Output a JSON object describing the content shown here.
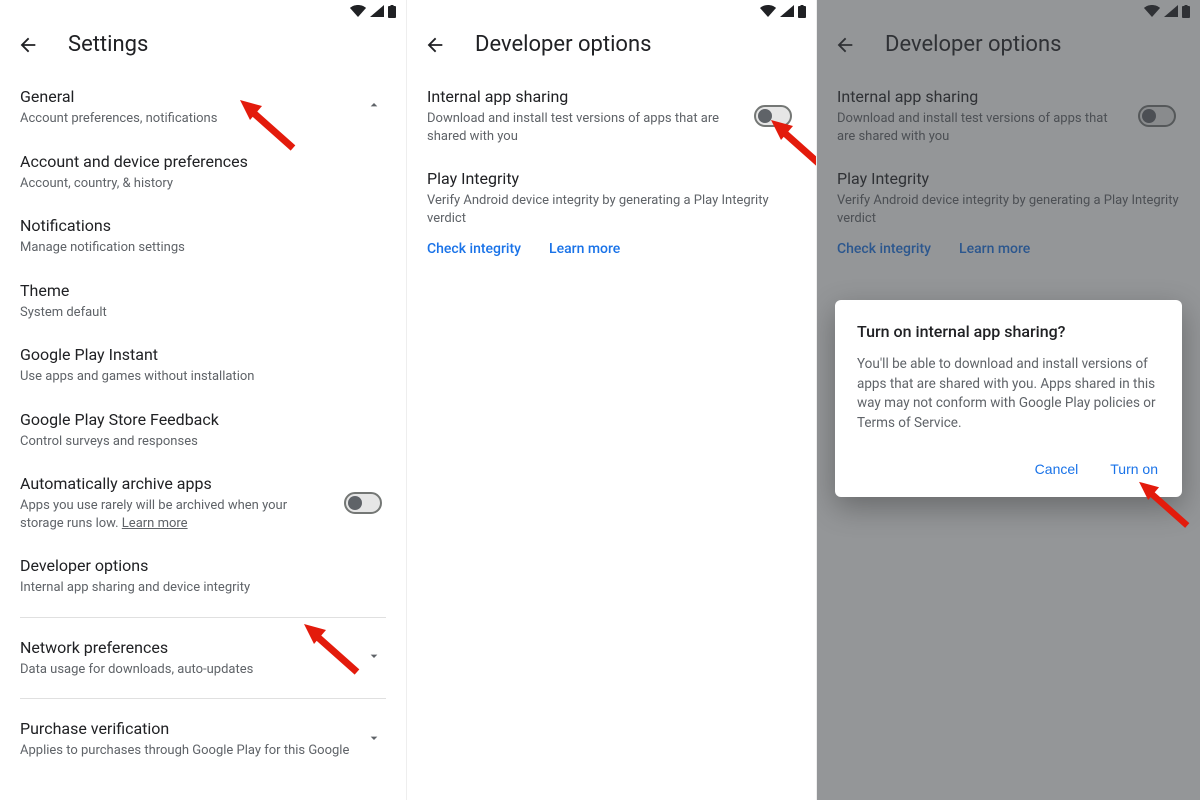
{
  "status_icons": [
    "wifi-icon",
    "signal-icon",
    "battery-icon"
  ],
  "phone1": {
    "title": "Settings",
    "rows": [
      {
        "title": "General",
        "sub": "Account preferences, notifications",
        "chevron": "up"
      },
      {
        "title": "Account and device preferences",
        "sub": "Account, country, & history"
      },
      {
        "title": "Notifications",
        "sub": "Manage notification settings"
      },
      {
        "title": "Theme",
        "sub": "System default"
      },
      {
        "title": "Google Play Instant",
        "sub": "Use apps and games without installation"
      },
      {
        "title": "Google Play Store Feedback",
        "sub": "Control surveys and responses"
      },
      {
        "title": "Automatically archive apps",
        "sub": "Apps you use rarely will be archived when your storage runs low. ",
        "learn_more": "Learn more",
        "toggle": false
      },
      {
        "title": "Developer options",
        "sub": "Internal app sharing and device integrity"
      },
      {
        "title": "Network preferences",
        "sub": "Data usage for downloads, auto-updates",
        "chevron": "down"
      },
      {
        "title": "Purchase verification",
        "sub": "Applies to purchases through Google Play for this Google",
        "chevron": "down"
      }
    ]
  },
  "phone2": {
    "title": "Developer options",
    "ias": {
      "title": "Internal app sharing",
      "sub": "Download and install test versions of apps that are shared with you",
      "toggle": false
    },
    "integrity": {
      "title": "Play Integrity",
      "sub": "Verify Android device integrity by generating a Play Integrity verdict",
      "link1": "Check integrity",
      "link2": "Learn more"
    }
  },
  "phone3": {
    "title": "Developer options",
    "ias": {
      "title": "Internal app sharing",
      "sub": "Download and install test versions of apps that are shared with you",
      "toggle": false
    },
    "integrity": {
      "title": "Play Integrity",
      "sub": "Verify Android device integrity by generating a Play Integrity verdict",
      "link1": "Check integrity",
      "link2": "Learn more"
    },
    "dialog": {
      "title": "Turn on internal app sharing?",
      "body": "You'll be able to download and install versions of apps that are shared with you. Apps shared in this way may not conform with Google Play policies or Terms of Service.",
      "cancel": "Cancel",
      "confirm": "Turn on"
    }
  }
}
